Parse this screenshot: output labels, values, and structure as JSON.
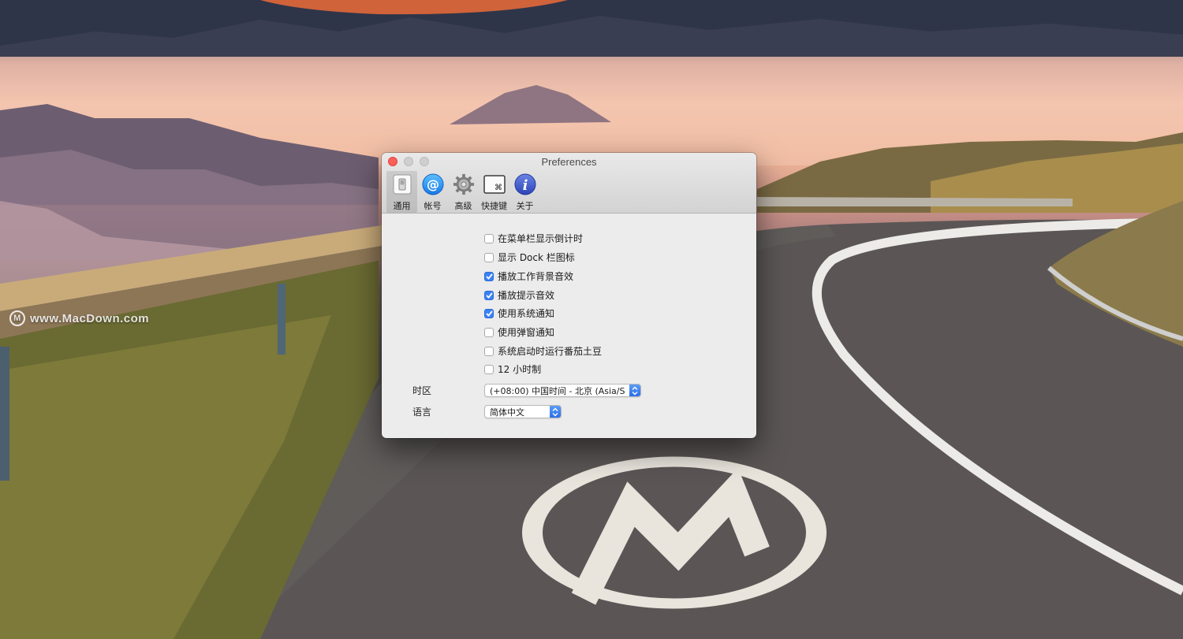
{
  "window": {
    "title": "Preferences"
  },
  "toolbar": {
    "items": [
      {
        "label": "通用",
        "icon": "switch-icon",
        "active": true
      },
      {
        "label": "帐号",
        "icon": "at-sign-icon",
        "active": false
      },
      {
        "label": "高级",
        "icon": "gear-icon",
        "active": false
      },
      {
        "label": "快捷键",
        "icon": "command-key-icon",
        "active": false
      },
      {
        "label": "关于",
        "icon": "info-icon",
        "active": false
      }
    ]
  },
  "options": [
    {
      "label": "在菜单栏显示倒计时",
      "checked": false
    },
    {
      "label": "显示 Dock 栏图标",
      "checked": false
    },
    {
      "label": "播放工作背景音效",
      "checked": true
    },
    {
      "label": "播放提示音效",
      "checked": true
    },
    {
      "label": "使用系统通知",
      "checked": true
    },
    {
      "label": "使用弹窗通知",
      "checked": false
    },
    {
      "label": "系统启动时运行番茄土豆",
      "checked": false
    },
    {
      "label": "12 小时制",
      "checked": false
    }
  ],
  "timezone": {
    "label": "时区",
    "value": "(+08:00) 中国时间 - 北京 (Asia/S"
  },
  "language": {
    "label": "语言",
    "value": "简体中文"
  },
  "watermark": {
    "text": "www.MacDown.com"
  },
  "colors": {
    "accent": "#3b82f6",
    "close": "#fc5f57"
  }
}
